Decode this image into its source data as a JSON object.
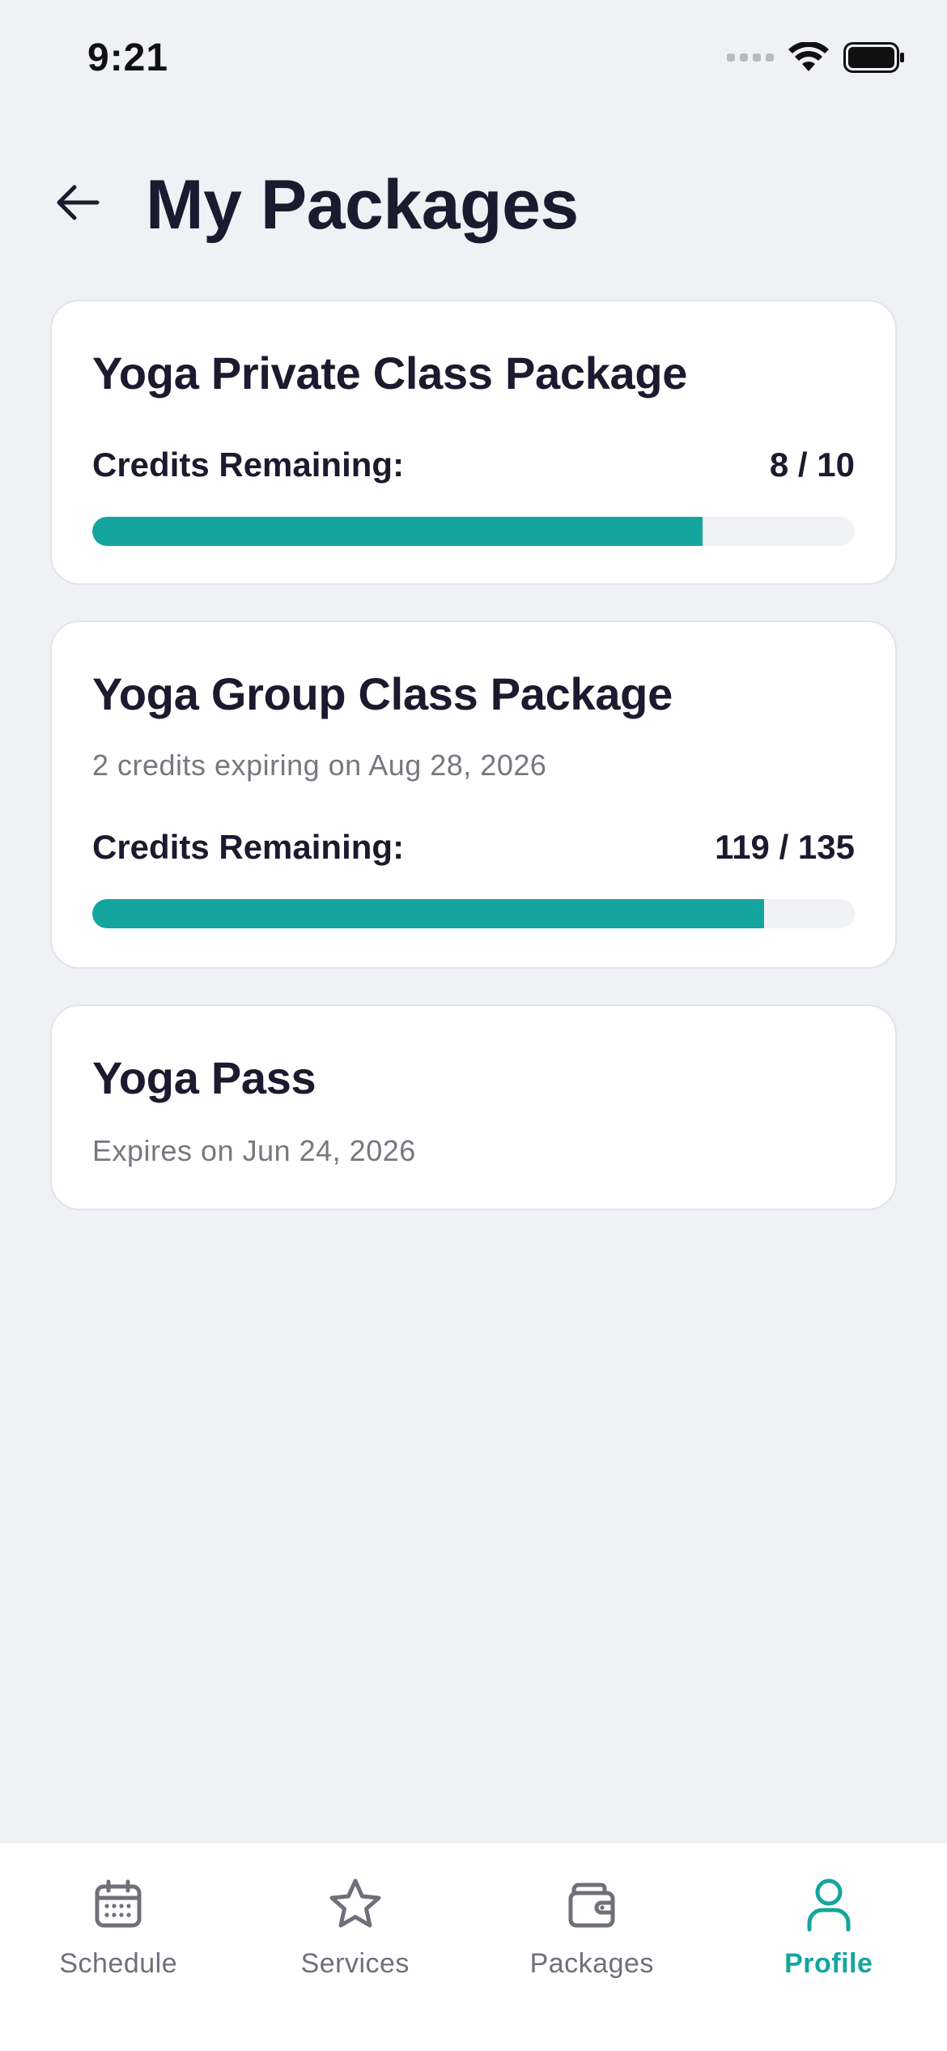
{
  "status": {
    "time": "9:21"
  },
  "header": {
    "title": "My Packages"
  },
  "packages": [
    {
      "title": "Yoga Private Class Package",
      "credits_label": "Credits Remaining:",
      "credits_value": "8 / 10",
      "progress": 0.8
    },
    {
      "title": "Yoga Group Class Package",
      "subtitle": "2 credits expiring on Aug 28, 2026",
      "credits_label": "Credits Remaining:",
      "credits_value": "119 / 135",
      "progress": 0.8815
    },
    {
      "title": "Yoga Pass",
      "subtitle": "Expires on Jun 24, 2026"
    }
  ],
  "tabs": [
    {
      "label": "Schedule",
      "icon": "calendar-icon"
    },
    {
      "label": "Services",
      "icon": "star-icon"
    },
    {
      "label": "Packages",
      "icon": "wallet-icon"
    },
    {
      "label": "Profile",
      "icon": "user-icon",
      "active": true
    }
  ],
  "colors": {
    "accent": "#14a59f",
    "title": "#1b1a2e",
    "muted": "#77787f",
    "background": "#f0f1f5"
  }
}
